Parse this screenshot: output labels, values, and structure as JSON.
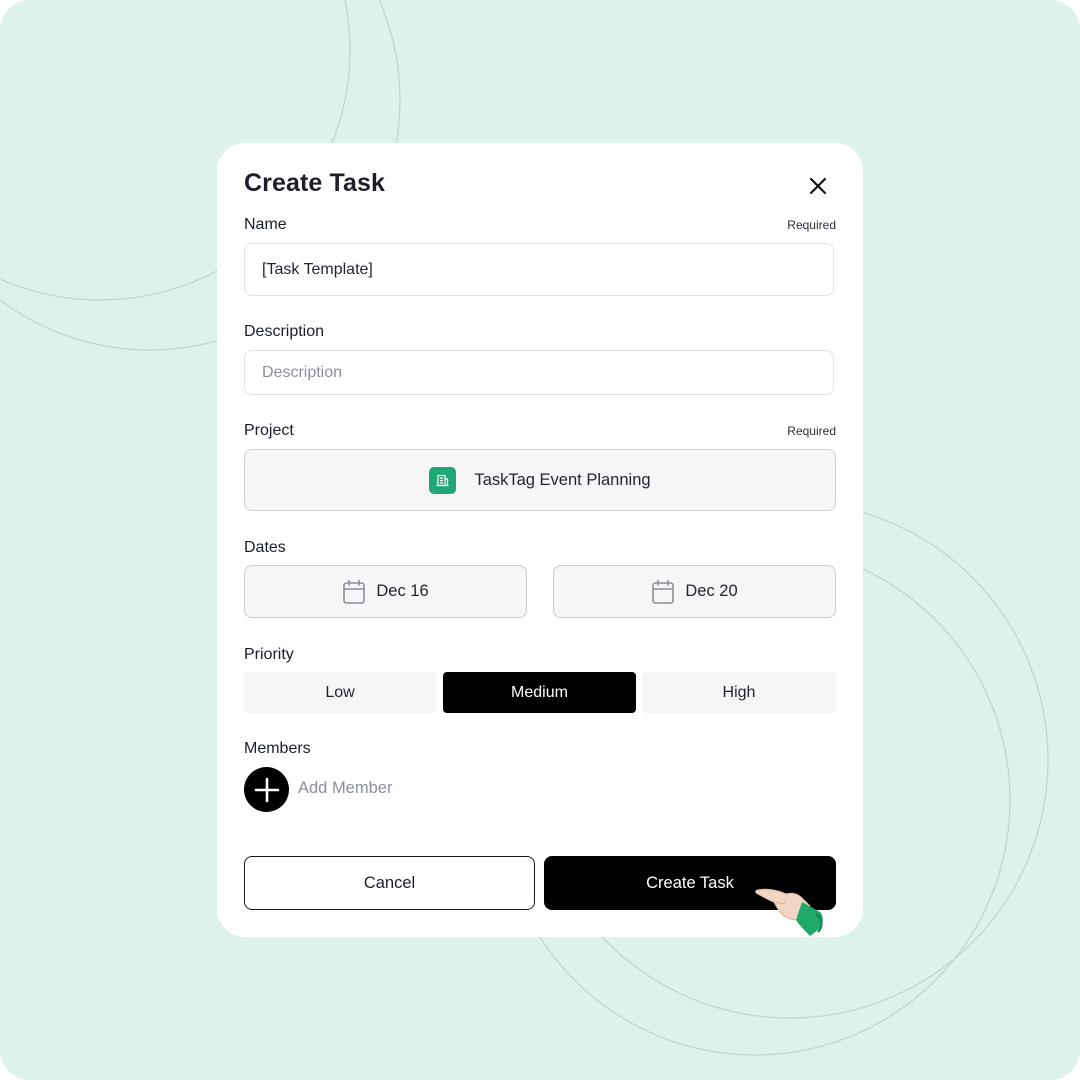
{
  "modal": {
    "title": "Create Task",
    "close_icon": "close-icon"
  },
  "name_field": {
    "label": "Name",
    "required": "Required",
    "value": "[Task Template]"
  },
  "description_field": {
    "label": "Description",
    "placeholder": "Description"
  },
  "project_field": {
    "label": "Project",
    "required": "Required",
    "value": "TaskTag Event Planning",
    "icon": "building-icon",
    "icon_color": "#20a775"
  },
  "dates": {
    "label": "Dates",
    "start": "Dec 16",
    "end": "Dec 20",
    "icon": "calendar-icon"
  },
  "priority": {
    "label": "Priority",
    "options": [
      "Low",
      "Medium",
      "High"
    ],
    "selected": "Medium"
  },
  "members": {
    "label": "Members",
    "add_label": "Add Member",
    "icon": "plus-icon"
  },
  "actions": {
    "cancel": "Cancel",
    "create": "Create Task"
  },
  "colors": {
    "background": "#dcf2eb",
    "primary": "#000000",
    "accent": "#20a775"
  }
}
